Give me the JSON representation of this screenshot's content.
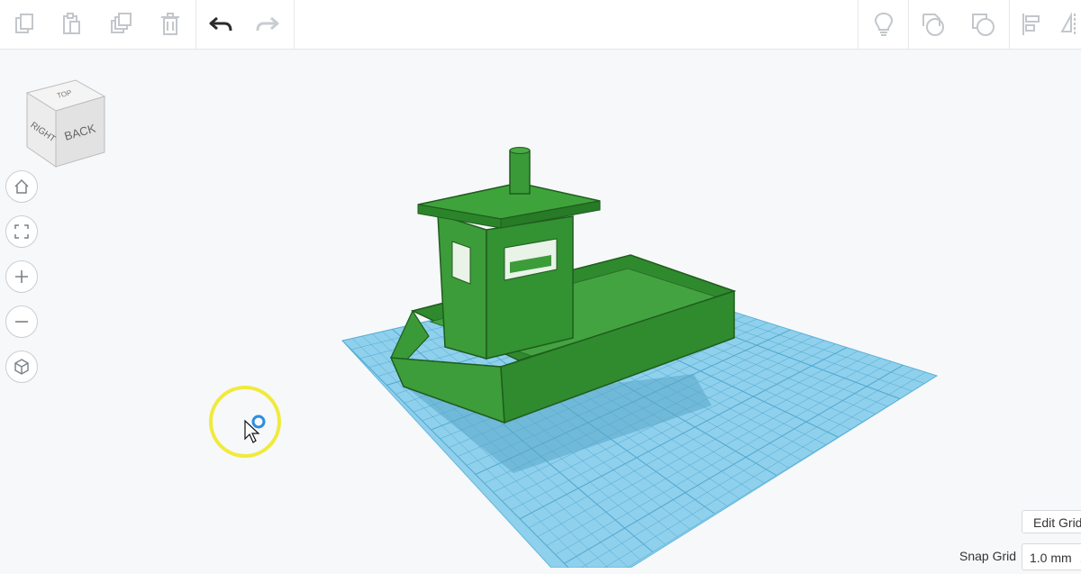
{
  "toolbar": {
    "left_icons": [
      "copy-icon",
      "paste-icon",
      "duplicate-icon",
      "delete-icon",
      "undo-icon",
      "redo-icon"
    ],
    "right_icons": [
      "lightbulb-icon",
      "shape-outline-icon",
      "shape-solid-icon",
      "align-icon",
      "mirror-icon"
    ]
  },
  "viewcube": {
    "faces": {
      "top": "TOP",
      "right": "RIGHT",
      "back": "BACK"
    }
  },
  "nav_buttons": [
    "home-view-icon",
    "fit-all-icon",
    "zoom-in-icon",
    "zoom-out-icon",
    "orthographic-view-icon"
  ],
  "workplane": {
    "color": "#8fd0ec",
    "grid_color": "#4fa7cf"
  },
  "model": {
    "name": "boat",
    "color": "#3a9a37"
  },
  "footer": {
    "edit_grid_label": "Edit Grid",
    "snap_grid_label": "Snap Grid",
    "snap_grid_value": "1.0 mm"
  },
  "colors": {
    "accent": "#3a9a37",
    "cursor_highlight": "#f0ea3c"
  }
}
